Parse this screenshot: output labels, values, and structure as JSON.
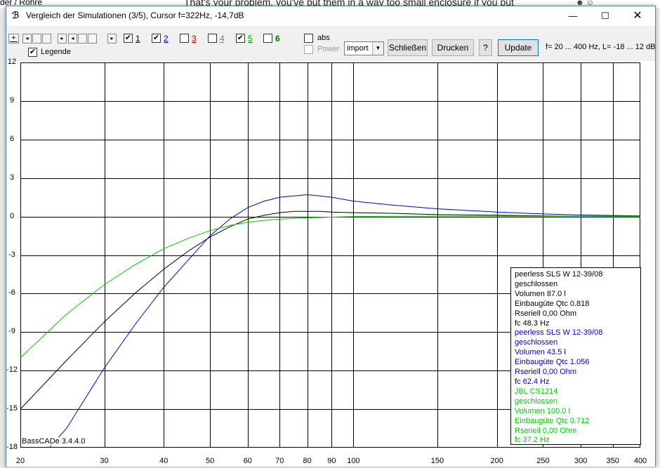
{
  "background": {
    "left_text": "der / Röhre",
    "mid_text": "That's your problem, you've put them in a way too small enclosure if you put"
  },
  "window": {
    "title": "Vergleich der Simulationen (3/5), Cursor f=322Hz, -14,7dB",
    "icon_glyph": "ℬ",
    "minimize": "—",
    "maximize": "☐",
    "close": "✕"
  },
  "toolbar": {
    "plus": "+",
    "nav_left": "◂",
    "nav_right": "▸",
    "traces": [
      {
        "label": "1",
        "checked": true,
        "color": "#000000"
      },
      {
        "label": "2",
        "checked": true,
        "color": "#0000cc"
      },
      {
        "label": "3",
        "checked": false,
        "color": "#cc0000"
      },
      {
        "label": "4",
        "checked": false,
        "color": "#808080"
      },
      {
        "label": "5",
        "checked": true,
        "color": "#00aa00"
      },
      {
        "label": "6",
        "checked": false,
        "color": "#007700"
      }
    ],
    "legend_label": "Legende",
    "legend_checked": true,
    "abs_label": "abs",
    "power_label": "Power",
    "select_value": "import",
    "close_button": "Schließen",
    "print_button": "Drucken",
    "help_button": "?",
    "update_button": "Update",
    "range_info": "f= 20 ... 400 Hz, L= -18 ... 12 dB"
  },
  "chart_data": {
    "type": "line",
    "x_scale": "log",
    "xlim": [
      20,
      400
    ],
    "ylim": [
      -18,
      12
    ],
    "x_ticks": [
      20,
      30,
      40,
      50,
      60,
      70,
      80,
      90,
      100,
      150,
      200,
      250,
      300,
      350,
      400
    ],
    "y_ticks": [
      12,
      9,
      6,
      3,
      0,
      -3,
      -6,
      -9,
      -12,
      -15,
      -18
    ],
    "grid": true,
    "annotation": "BassCADe 3.4.4.0",
    "series": [
      {
        "name": "peerless SLS W 12-39/08",
        "color": "#000000",
        "x": [
          20,
          25,
          30,
          35,
          40,
          45,
          50,
          55,
          60,
          65,
          70,
          75,
          80,
          85,
          90,
          100,
          120,
          150,
          200,
          250,
          300,
          350,
          400
        ],
        "y": [
          -15.0,
          -11.2,
          -8.2,
          -5.9,
          -4.1,
          -2.7,
          -1.6,
          -0.8,
          -0.2,
          0.1,
          0.3,
          0.4,
          0.4,
          0.4,
          0.35,
          0.3,
          0.25,
          0.15,
          0.1,
          0.05,
          0.03,
          0.02,
          0.01
        ]
      },
      {
        "name": "peerless SLS W 12-39/08",
        "color": "#0000cc",
        "x": [
          23,
          25,
          30,
          35,
          40,
          45,
          50,
          55,
          60,
          65,
          70,
          75,
          80,
          85,
          90,
          100,
          120,
          150,
          200,
          250,
          300,
          350,
          400
        ],
        "y": [
          -18.0,
          -16.5,
          -11.8,
          -8.3,
          -5.5,
          -3.4,
          -1.5,
          -0.2,
          0.7,
          1.2,
          1.5,
          1.6,
          1.7,
          1.6,
          1.5,
          1.2,
          0.9,
          0.6,
          0.35,
          0.2,
          0.12,
          0.08,
          0.05
        ]
      },
      {
        "name": "JBL CS1214",
        "color": "#00cc00",
        "x": [
          20,
          25,
          30,
          35,
          40,
          45,
          50,
          55,
          60,
          65,
          70,
          80,
          90,
          100,
          120,
          150,
          200,
          250,
          300,
          350,
          400
        ],
        "y": [
          -11.0,
          -7.6,
          -5.3,
          -3.7,
          -2.5,
          -1.7,
          -1.1,
          -0.7,
          -0.45,
          -0.3,
          -0.2,
          -0.1,
          -0.05,
          0.0,
          0.02,
          0.03,
          0.03,
          0.02,
          0.02,
          0.01,
          0.01
        ]
      }
    ]
  },
  "legend": {
    "entries": [
      {
        "color": "#000000",
        "lines": [
          "peerless SLS W 12-39/08",
          "geschlossen",
          "Volumen 87.0 l",
          "Einbaugüte Qtc 0.818",
          "Rseriell 0,00 Ohm",
          "fc 48.3 Hz"
        ]
      },
      {
        "color": "#0000cc",
        "lines": [
          "peerless SLS W 12-39/08",
          "geschlossen",
          "Volumen 43.5 l",
          "Einbaugüte Qtc 1.056",
          "Rseriell 0,00 Ohm",
          "fc 62.4 Hz"
        ]
      },
      {
        "color": "#00cc00",
        "lines": [
          "JBL CS1214",
          "geschlossen",
          "Volumen 100.0 l",
          "Einbaugüte Qtc 0.712",
          "Rseriell 0,00 Ohm",
          "fc 37.2 Hz"
        ]
      }
    ]
  }
}
